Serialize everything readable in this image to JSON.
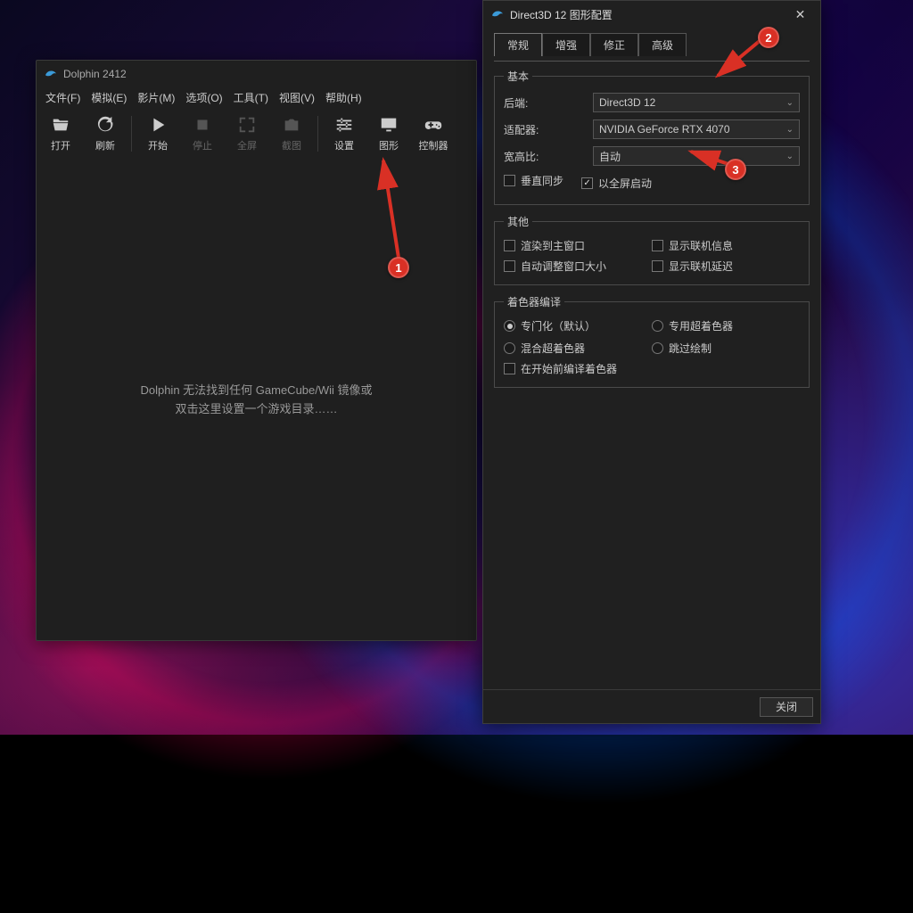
{
  "main": {
    "title": "Dolphin 2412",
    "menu": [
      "文件(F)",
      "模拟(E)",
      "影片(M)",
      "选项(O)",
      "工具(T)",
      "视图(V)",
      "帮助(H)"
    ],
    "toolbar": [
      {
        "key": "open",
        "label": "打开"
      },
      {
        "key": "refresh",
        "label": "刷新"
      },
      {
        "key": "sep"
      },
      {
        "key": "play",
        "label": "开始"
      },
      {
        "key": "stop",
        "label": "停止",
        "dis": true
      },
      {
        "key": "fullscreen",
        "label": "全屏",
        "dis": true
      },
      {
        "key": "screenshot",
        "label": "截图",
        "dis": true
      },
      {
        "key": "sep"
      },
      {
        "key": "settings",
        "label": "设置"
      },
      {
        "key": "graphics",
        "label": "图形"
      },
      {
        "key": "controllers",
        "label": "控制器"
      }
    ],
    "empty_msg": "Dolphin 无法找到任何 GameCube/Wii 镜像或\n双击这里设置一个游戏目录……"
  },
  "dialog": {
    "title": "Direct3D 12 图形配置",
    "tabs": [
      "常规",
      "增强",
      "修正",
      "高级"
    ],
    "active_tab": 0,
    "group_basic": {
      "legend": "基本",
      "backend_label": "后端:",
      "backend_value": "Direct3D 12",
      "adapter_label": "适配器:",
      "adapter_value": "NVIDIA GeForce RTX 4070",
      "aspect_label": "宽高比:",
      "aspect_value": "自动",
      "vsync_label": "垂直同步",
      "fullscreen_label": "以全屏启动",
      "vsync_checked": false,
      "fullscreen_checked": true
    },
    "group_other": {
      "legend": "其他",
      "items": [
        {
          "label": "渲染到主窗口",
          "checked": false
        },
        {
          "label": "显示联机信息",
          "checked": false
        },
        {
          "label": "自动调整窗口大小",
          "checked": false
        },
        {
          "label": "显示联机延迟",
          "checked": false
        }
      ]
    },
    "group_shader": {
      "legend": "着色器编译",
      "radios": [
        {
          "label": "专门化（默认）",
          "sel": true
        },
        {
          "label": "专用超着色器",
          "sel": false
        },
        {
          "label": "混合超着色器",
          "sel": false
        },
        {
          "label": "跳过绘制",
          "sel": false
        }
      ],
      "precompile_label": "在开始前编译着色器",
      "precompile_checked": false
    },
    "close_label": "关闭"
  },
  "markers": {
    "m1": "1",
    "m2": "2",
    "m3": "3"
  }
}
